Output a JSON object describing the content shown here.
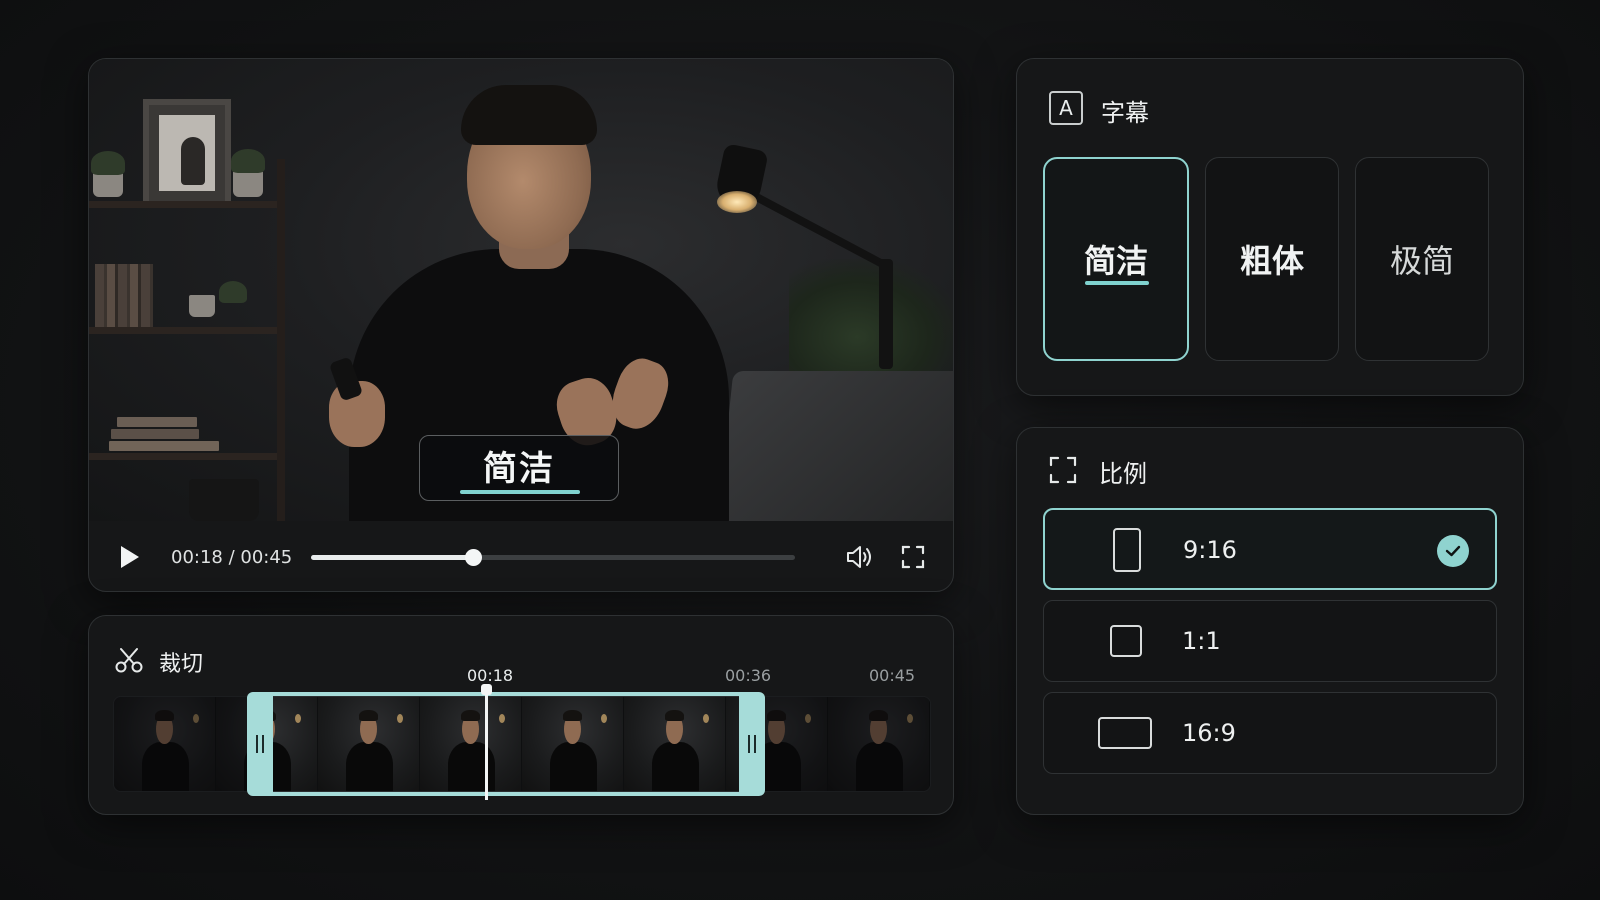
{
  "player": {
    "caption_preview": "简洁",
    "time": "00:18 / 00:45",
    "progress": 0.335
  },
  "trim": {
    "title": "裁切",
    "ticks": [
      "00:18",
      "00:36",
      "00:45"
    ],
    "frame_count": 8
  },
  "subtitle": {
    "icon_letter": "A",
    "title": "字幕",
    "styles": [
      {
        "label": "简洁",
        "selected": true
      },
      {
        "label": "粗体",
        "selected": false
      },
      {
        "label": "极简",
        "selected": false
      }
    ]
  },
  "ratio": {
    "title": "比例",
    "options": [
      {
        "label": "9:16",
        "selected": true
      },
      {
        "label": "1:1",
        "selected": false
      },
      {
        "label": "16:9",
        "selected": false
      }
    ]
  },
  "colors": {
    "accent": "#8fd3cf",
    "panel": "#161718",
    "background": "#121314"
  },
  "icons": {
    "play": "play-icon",
    "volume": "volume-icon",
    "fullscreen": "fullscreen-icon",
    "scissors": "scissors-icon",
    "aspect": "aspect-ratio-icon",
    "check": "check-icon"
  }
}
